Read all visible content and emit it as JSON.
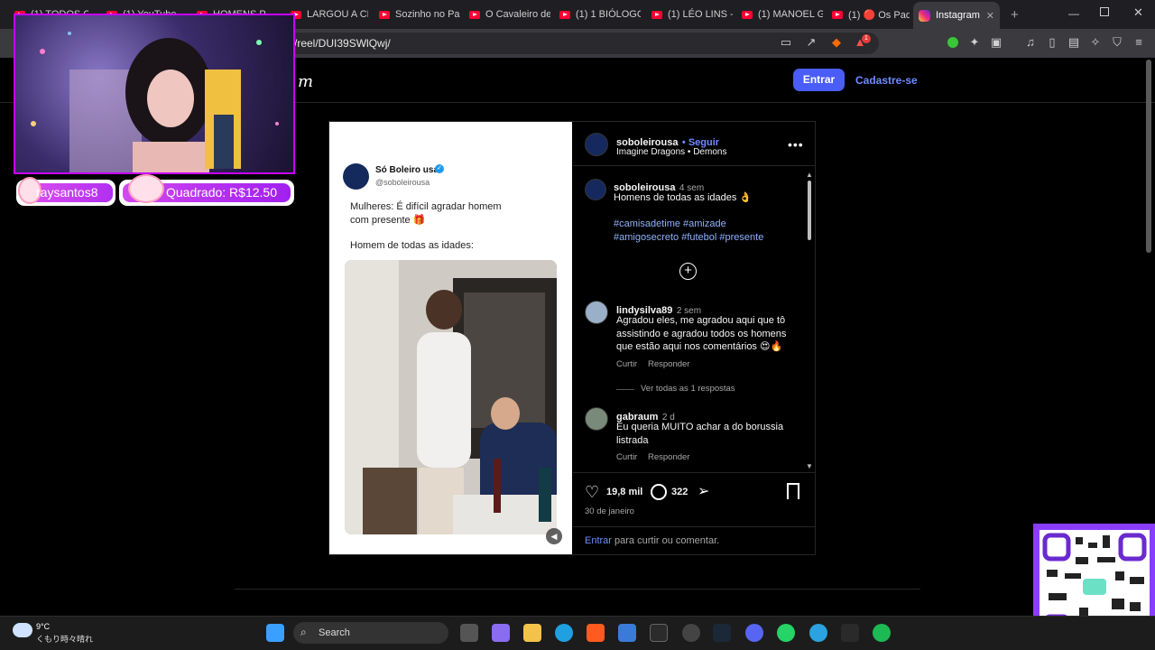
{
  "browser": {
    "tabs": [
      {
        "label": "(1) TODOS O"
      },
      {
        "label": "(1) YouTube"
      },
      {
        "label": "HOMENS P"
      },
      {
        "label": "LARGOU A CL"
      },
      {
        "label": "Sozinho no Pa"
      },
      {
        "label": "O Cavaleiro de"
      },
      {
        "label": "(1) 1 BIÓLOGO"
      },
      {
        "label": "(1) LÉO LINS -"
      },
      {
        "label": "(1) MANOEL G"
      },
      {
        "label": "(1) 🔴 Os Pad"
      },
      {
        "label": "Instagram"
      }
    ],
    "url": "/reel/DUI39SWlQwj/",
    "notification_count": "1"
  },
  "site_header": {
    "brand_fragment": "m",
    "login_button": "Entrar",
    "signup_link": "Cadastre-se"
  },
  "tweet": {
    "name": "Só Boleiro usa",
    "handle": "@soboleirousa",
    "line1": "Mulheres: É difícil agradar homem com presente 🎁",
    "line2": "Homem de todas as idades:"
  },
  "post": {
    "author": "soboleirousa",
    "follow": "• Seguir",
    "music": "Imagine Dragons • Demons",
    "caption": {
      "author": "soboleirousa",
      "time": "4 sem",
      "text": "Homens de todas as idades 👌",
      "hashtags_l1": "#camisadetime #amizade",
      "hashtags_l2": "#amigosecreto #futebol #presente"
    },
    "comments": [
      {
        "user": "lindysilva89",
        "time": "2 sem",
        "text": "Agradou eles, me agradou aqui que tô assistindo e agradou todos os homens que estão aqui nos comentários 😍🔥",
        "like": "Curtir",
        "reply": "Responder",
        "view_replies": "Ver todas as 1 respostas"
      },
      {
        "user": "gabraum",
        "time": "2 d",
        "text": "Eu queria MUITO achar a do borussia listrada",
        "like": "Curtir",
        "reply": "Responder"
      }
    ],
    "likes": "19,8 mil",
    "comments_count": "322",
    "date": "30 de janeiro",
    "login_prompt_link": "Entrar",
    "login_prompt_rest": "para curtir ou comentar."
  },
  "overlay": {
    "username": "raysantos8",
    "goal": "Quadrado: R$12.50"
  },
  "taskbar": {
    "temp": "9°C",
    "weather": "くもり時々晴れ",
    "search": "Search"
  },
  "colors": {
    "accent": "#4a5df9",
    "link": "#8fb0ff",
    "overlay_border": "#c800ff"
  }
}
